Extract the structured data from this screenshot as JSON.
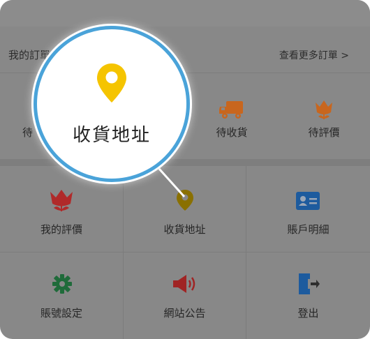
{
  "orders": {
    "title": "我的訂單",
    "more_link": "查看更多訂單 >",
    "row": [
      {
        "label": "待收貨",
        "icon": "truck-icon"
      },
      {
        "label": "待評價",
        "icon": "tulip-icon"
      }
    ],
    "partial_label": "待"
  },
  "grid": [
    {
      "label": "我的評價",
      "icon": "tulip-icon"
    },
    {
      "label": "收貨地址",
      "icon": "location-pin-icon"
    },
    {
      "label": "賬戶明細",
      "icon": "id-card-icon"
    },
    {
      "label": "賬號設定",
      "icon": "gear-icon"
    },
    {
      "label": "網站公告",
      "icon": "megaphone-icon"
    },
    {
      "label": "登出",
      "icon": "logout-door-icon"
    }
  ],
  "magnifier": {
    "label": "收貨地址",
    "icon": "location-pin-icon"
  },
  "colors": {
    "overlay": "#888888",
    "pin": "#f5c400",
    "pin_dim": "#8a7000",
    "truck": "#c8661e",
    "tulip_orange": "#c8661e",
    "tulip_red": "#b02a2a",
    "id_card": "#1d5b9e",
    "gear": "#1f6b3a",
    "megaphone": "#a02424",
    "door": "#1d5b9e",
    "ring": "#4aa3d9"
  }
}
